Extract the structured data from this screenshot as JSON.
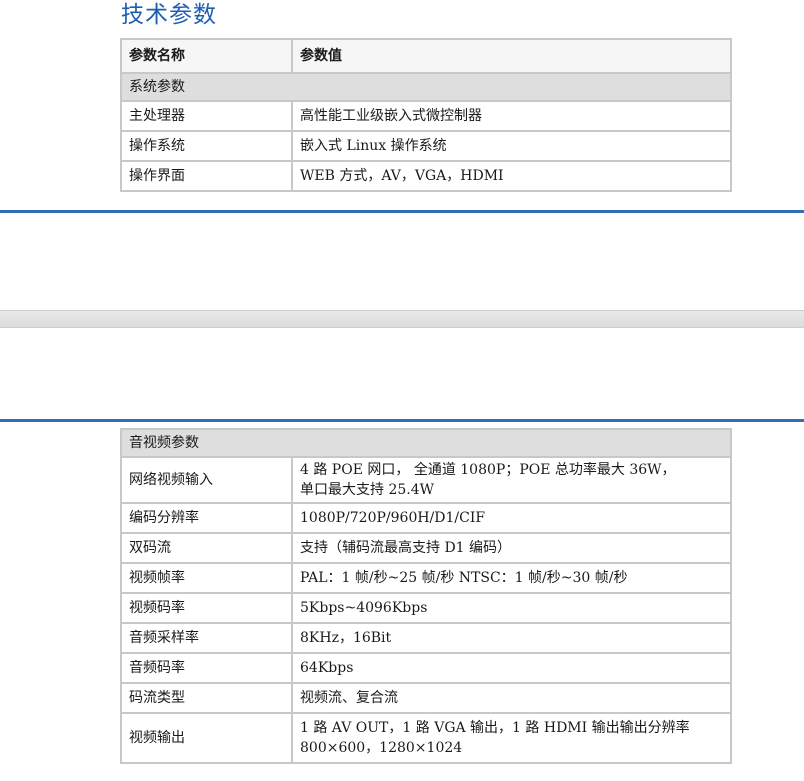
{
  "page": {
    "title": "技术参数"
  },
  "table_system": {
    "header": {
      "name": "参数名称",
      "value": "参数值"
    },
    "section": "系统参数",
    "rows": [
      {
        "name": "主处理器",
        "value": "高性能工业级嵌入式微控制器"
      },
      {
        "name": "操作系统",
        "value": "嵌入式 Linux 操作系统"
      },
      {
        "name": "操作界面",
        "value": "WEB 方式，AV，VGA，HDMI"
      }
    ]
  },
  "table_av": {
    "section": "音视频参数",
    "rows": [
      {
        "name": "网络视频输入",
        "value_line1": "4 路 POE 网口， 全通道 1080P；POE 总功率最大 36W，",
        "value_line2": "单口最大支持 25.4W"
      },
      {
        "name": "编码分辨率",
        "value": "1080P/720P/960H/D1/CIF"
      },
      {
        "name": "双码流",
        "value": "支持（辅码流最高支持 D1 编码）"
      },
      {
        "name": "视频帧率",
        "value": "PAL：1 帧/秒~25 帧/秒 NTSC：1 帧/秒~30 帧/秒"
      },
      {
        "name": "视频码率",
        "value": "5Kbps~4096Kbps"
      },
      {
        "name": "音频采样率",
        "value": "8KHz，16Bit"
      },
      {
        "name": "音频码率",
        "value": "64Kbps"
      },
      {
        "name": "码流类型",
        "value": "视频流、复合流"
      },
      {
        "name": "视频输出",
        "value_line1": "1 路 AV OUT，1 路 VGA 输出，1 路 HDMI 输出输出分辨率",
        "value_line2": "800×600，1280×1024"
      }
    ]
  },
  "colors": {
    "title": "#1f5fb0",
    "rule": "#2f6fb5",
    "border": "#c8c8c8",
    "section_bg": "#dedede"
  }
}
